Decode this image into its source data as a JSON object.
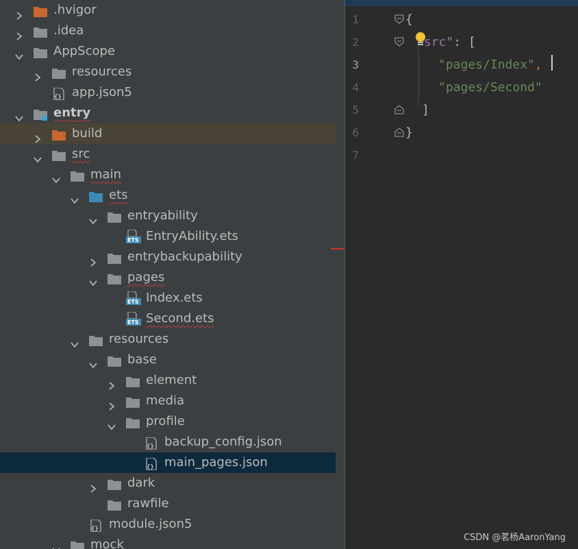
{
  "colors": {
    "tree_bg": "#3c3f41",
    "editor_bg": "#2b2b2b",
    "folder_orange": "#c8672f",
    "folder_gray": "#8c9195",
    "folder_blue": "#3d8bb5",
    "selection": "#0d293e",
    "highlight_row": "#4a4437",
    "json_key": "#9876aa",
    "json_string": "#6a8759",
    "json_punctuation": "#cc7832"
  },
  "tree": [
    {
      "label": ".hvigor",
      "icon": "folder-orange-icon",
      "chevron": "right",
      "state": "normal"
    },
    {
      "label": ".idea",
      "icon": "folder-gray-icon",
      "chevron": "right",
      "state": "normal"
    },
    {
      "label": "AppScope",
      "icon": "folder-gray-icon",
      "chevron": "down",
      "state": "normal"
    },
    {
      "label": "resources",
      "icon": "folder-gray-icon",
      "chevron": "right",
      "state": "normal"
    },
    {
      "label": "app.json5",
      "icon": "json-file-icon",
      "chevron": "none",
      "state": "normal"
    },
    {
      "label": "entry",
      "icon": "module-folder-icon",
      "chevron": "down",
      "state": "bold-squiggle"
    },
    {
      "label": "build",
      "icon": "folder-orange-icon",
      "chevron": "right",
      "state": "highlighted"
    },
    {
      "label": "src",
      "icon": "folder-gray-icon",
      "chevron": "down",
      "state": "squiggle"
    },
    {
      "label": "main",
      "icon": "folder-gray-icon",
      "chevron": "down",
      "state": "squiggle"
    },
    {
      "label": "ets",
      "icon": "folder-blue-icon",
      "chevron": "down",
      "state": "squiggle"
    },
    {
      "label": "entryability",
      "icon": "folder-gray-icon",
      "chevron": "down",
      "state": "normal"
    },
    {
      "label": "EntryAbility.ets",
      "icon": "ets-file-icon",
      "chevron": "none",
      "state": "normal"
    },
    {
      "label": "entrybackupability",
      "icon": "folder-gray-icon",
      "chevron": "right",
      "state": "normal"
    },
    {
      "label": "pages",
      "icon": "folder-gray-icon",
      "chevron": "down",
      "state": "squiggle"
    },
    {
      "label": "Index.ets",
      "icon": "ets-file-icon",
      "chevron": "none",
      "state": "normal"
    },
    {
      "label": "Second.ets",
      "icon": "ets-file-icon",
      "chevron": "none",
      "state": "squiggle"
    },
    {
      "label": "resources",
      "icon": "folder-gray-icon",
      "chevron": "down",
      "state": "normal"
    },
    {
      "label": "base",
      "icon": "folder-gray-icon",
      "chevron": "down",
      "state": "normal"
    },
    {
      "label": "element",
      "icon": "folder-gray-icon",
      "chevron": "right",
      "state": "normal"
    },
    {
      "label": "media",
      "icon": "folder-gray-icon",
      "chevron": "right",
      "state": "normal"
    },
    {
      "label": "profile",
      "icon": "folder-gray-icon",
      "chevron": "down",
      "state": "normal"
    },
    {
      "label": "backup_config.json",
      "icon": "json-file-icon",
      "chevron": "none",
      "state": "normal"
    },
    {
      "label": "main_pages.json",
      "icon": "json-file-icon",
      "chevron": "none",
      "state": "selected"
    },
    {
      "label": "dark",
      "icon": "folder-gray-icon",
      "chevron": "right",
      "state": "normal"
    },
    {
      "label": "rawfile",
      "icon": "folder-gray-icon",
      "chevron": "none",
      "state": "normal"
    },
    {
      "label": "module.json5",
      "icon": "json-file-icon",
      "chevron": "none",
      "state": "normal"
    },
    {
      "label": "mock",
      "icon": "folder-gray-icon",
      "chevron": "down",
      "state": "normal"
    }
  ],
  "editor": {
    "line_numbers": [
      "1",
      "2",
      "3",
      "4",
      "5",
      "6",
      "7"
    ],
    "current_line": "3",
    "lines": [
      [
        {
          "t": "{",
          "k": "plain"
        }
      ],
      [
        {
          "t": "\"src\"",
          "k": "key"
        },
        {
          "t": ": [",
          "k": "plain"
        }
      ],
      [
        {
          "t": "\"pages/Index\"",
          "k": "str"
        },
        {
          "t": ",",
          "k": "punc"
        }
      ],
      [
        {
          "t": "\"pages/Second\"",
          "k": "str"
        }
      ],
      [
        {
          "t": "]",
          "k": "plain"
        }
      ],
      [
        {
          "t": "}",
          "k": "plain"
        }
      ],
      []
    ]
  },
  "watermark": "CSDN @茗杨AaronYang"
}
